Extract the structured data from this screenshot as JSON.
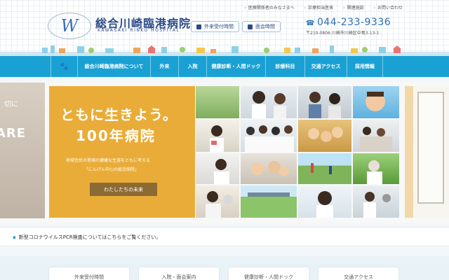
{
  "top_links": [
    "医療関係者のみなさまへ",
    "診療担当医表",
    "関連施設",
    "お問い合わせ"
  ],
  "logo": {
    "mark": "W",
    "title": "総合川崎臨港病院",
    "subtitle": "KAWASAKI RINKO HOSPITAL"
  },
  "header_buttons": [
    {
      "label": "外来受付時間",
      "icon": "clock-icon"
    },
    {
      "label": "面会時間",
      "icon": "building-icon"
    }
  ],
  "contact": {
    "phone_icon": "☎",
    "phone": "044-233-9336",
    "address": "〒210-0806 川崎市川崎区中島3-13-1"
  },
  "nav": {
    "home_icon": "🐾",
    "items": [
      "総合川崎臨港病院について",
      "外来",
      "入院",
      "健康診断・人間ドック",
      "診療科目",
      "交通アクセス",
      "採用情報"
    ]
  },
  "hero": {
    "left_text_top": "切に",
    "left_text_big": "ARE",
    "slogan_line1": "ともに生きよう。",
    "slogan_line2": "100年病院",
    "sub_line1": "地域住民の皆様の健康な生涯をともに考える",
    "sub_line2": "「にんげん中心の総合病院」",
    "button": "わたしたちの未来"
  },
  "notice": {
    "text": "新型コロナウイルスPCR検査についてはこちらをご覧ください。"
  },
  "bottom_cards": [
    "外来受付時間",
    "入院・面会案内",
    "健康診断・人間ドック",
    "交通アクセス"
  ],
  "colors": {
    "nav_blue": "#1aa1d4",
    "brand_navy": "#2d4a87",
    "hero_yellow": "#e9ac38",
    "button_brown": "#8c6a33"
  }
}
